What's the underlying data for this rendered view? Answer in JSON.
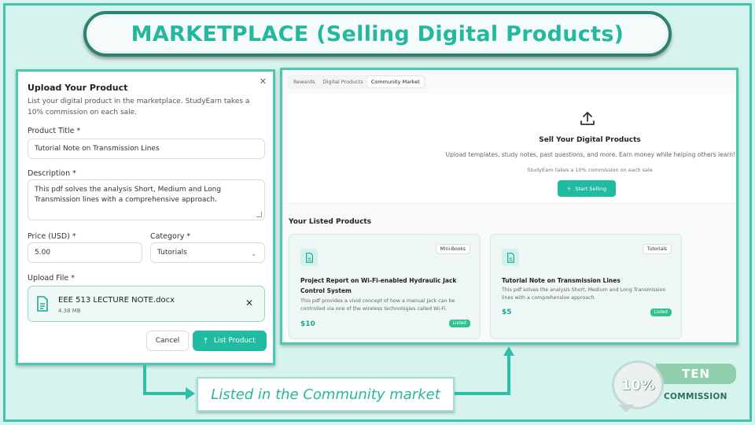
{
  "slide": {
    "title": "MARKETPLACE (Selling Digital Products)",
    "caption": "Listed in the Community market"
  },
  "upload_form": {
    "title": "Upload Your Product",
    "description": "List your digital product in the marketplace. StudyEarn takes a 10% commission on each sale.",
    "product_title_label": "Product Title *",
    "product_title_value": "Tutorial Note on Transmission Lines",
    "description_label": "Description *",
    "description_value": "This pdf solves the analysis Short, Medium and Long Transmission lines with a comprehensive approach.",
    "price_label": "Price (USD) *",
    "price_value": "5.00",
    "category_label": "Category *",
    "category_value": "Tutorials",
    "upload_label": "Upload File *",
    "file_name": "EEE 513 LECTURE NOTE.docx",
    "file_size": "4.38 MB",
    "cancel_label": "Cancel",
    "list_label": "List Product"
  },
  "marketplace": {
    "tabs": [
      {
        "label": "Rewards"
      },
      {
        "label": "Digital Products"
      },
      {
        "label": "Community Market"
      }
    ],
    "active_tab": "Community Market",
    "hero_title": "Sell Your Digital Products",
    "hero_subtitle": "Upload templates, study notes, past questions, and more. Earn money while helping others learn!",
    "hero_note": "StudyEarn takes a 10% commission on each sale",
    "sell_button": "Start Selling",
    "listed_heading": "Your Listed Products",
    "products": [
      {
        "category": "Mini-Books",
        "title": "Project Report on Wi-Fi-enabled Hydraulic Jack Control System",
        "description": "This pdf provides a vivid concept of how a manual Jack can be controlled via one of the wireless technologies called Wi-Fi.",
        "price": "$10",
        "status": "Listed"
      },
      {
        "category": "Tutorials",
        "title": "Tutorial Note on Transmission Lines",
        "description": "This pdf solves the analysis Short, Medium and Long Transmission lines with a comprehensive approach.",
        "price": "$5",
        "status": "Listed"
      }
    ]
  },
  "commission_badge": {
    "percent": "10%",
    "word": "TEN",
    "label": "COMMISSION"
  },
  "colors": {
    "accent": "#20bba0",
    "background": "#d7f3ee",
    "title_text": "#24b89f",
    "listed_badge": "#2fc28b"
  }
}
